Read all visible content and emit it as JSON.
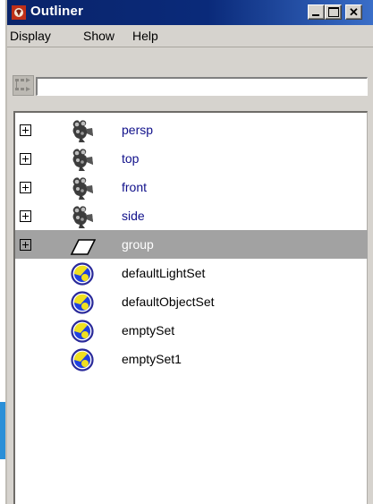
{
  "window": {
    "title": "Outliner"
  },
  "menu": [
    "Display",
    "Show",
    "Help"
  ],
  "filter": {
    "value": "",
    "placeholder": ""
  },
  "outliner": {
    "items": [
      {
        "label": "persp",
        "kind": "camera",
        "expandable": true,
        "selected": false
      },
      {
        "label": "top",
        "kind": "camera",
        "expandable": true,
        "selected": false
      },
      {
        "label": "front",
        "kind": "camera",
        "expandable": true,
        "selected": false
      },
      {
        "label": "side",
        "kind": "camera",
        "expandable": true,
        "selected": false
      },
      {
        "label": "group",
        "kind": "group",
        "expandable": true,
        "selected": true
      },
      {
        "label": "defaultLightSet",
        "kind": "set",
        "expandable": false,
        "selected": false
      },
      {
        "label": "defaultObjectSet",
        "kind": "set",
        "expandable": false,
        "selected": false
      },
      {
        "label": "emptySet",
        "kind": "set",
        "expandable": false,
        "selected": false
      },
      {
        "label": "emptySet1",
        "kind": "set",
        "expandable": false,
        "selected": false
      }
    ]
  },
  "colors": {
    "title_bar": "#0a246a",
    "selection": "#a2a2a2",
    "camera_text": "#10108a",
    "set_icon_yellow": "#f0e020",
    "set_icon_blue": "#2040e0"
  }
}
